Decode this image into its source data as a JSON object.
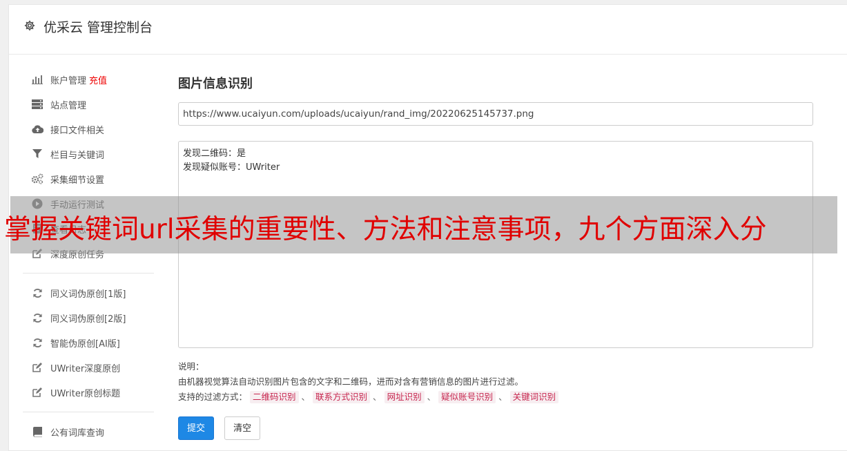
{
  "header": {
    "title": "优采云 管理控制台"
  },
  "sidebar": {
    "groups": [
      [
        {
          "label": "账户管理",
          "extra": "充值",
          "icon": "bar-chart-icon"
        },
        {
          "label": "站点管理",
          "icon": "server-icon"
        },
        {
          "label": "接口文件相关",
          "icon": "cloud-upload-icon"
        },
        {
          "label": "栏目与关键词",
          "icon": "filter-icon"
        },
        {
          "label": "采集细节设置",
          "icon": "cogs-icon"
        },
        {
          "label": "手动运行测试",
          "icon": "play-circle-icon"
        },
        {
          "label": "查看日志",
          "icon": "log-icon"
        },
        {
          "label": "深度原创任务",
          "icon": "edit-icon"
        }
      ],
      [
        {
          "label": "同义词伪原创[1版]",
          "icon": "refresh-icon"
        },
        {
          "label": "同义词伪原创[2版]",
          "icon": "refresh-icon"
        },
        {
          "label": "智能伪原创[AI版]",
          "icon": "refresh-icon"
        },
        {
          "label": "UWriter深度原创",
          "icon": "edit-icon"
        },
        {
          "label": "UWriter原创标题",
          "icon": "edit-icon"
        }
      ],
      [
        {
          "label": "公有词库查询",
          "icon": "book-icon"
        }
      ]
    ]
  },
  "main": {
    "title": "图片信息识别",
    "url_value": "https://www.ucaiyun.com/uploads/ucaiyun/rand_img/20220625145737.png",
    "result_lines": [
      "发现二维码：是",
      "发现疑似账号：UWriter"
    ],
    "desc_label": "说明：",
    "desc_text": "由机器视觉算法自动识别图片包含的文字和二维码，进而对含有营销信息的图片进行过滤。",
    "filter_label": "支持的过滤方式：",
    "filter_tags": [
      "二维码识别",
      "联系方式识别",
      "网址识别",
      "疑似账号识别",
      "关键词识别"
    ],
    "filter_sep": "、",
    "submit_label": "提交",
    "clear_label": "清空"
  },
  "overlay": {
    "text": "掌握关键词url采集的重要性、方法和注意事项，九个方面深入分"
  },
  "colors": {
    "primary": "#1e88e5",
    "overlay_text": "#e00000",
    "tag_text": "#c7254e"
  }
}
